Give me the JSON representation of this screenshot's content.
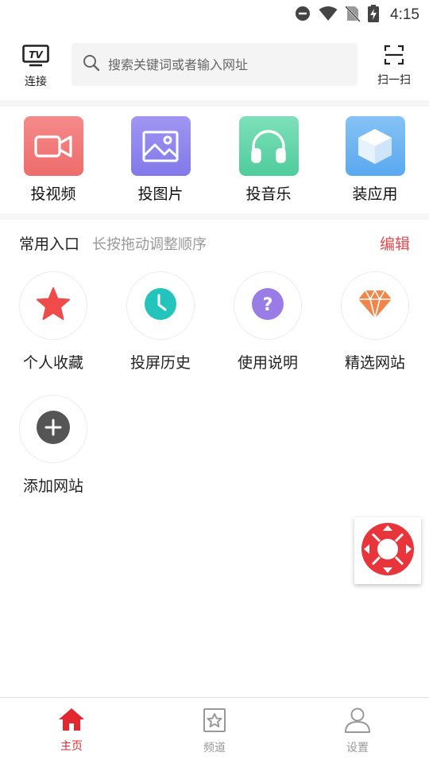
{
  "status_bar": {
    "time": "4:15",
    "icons": [
      "do-not-disturb-icon",
      "wifi-icon",
      "no-sim-icon",
      "battery-charging-icon"
    ]
  },
  "header": {
    "tv_label": "连接",
    "tv_icon_text": "TV",
    "search_placeholder": "搜索关键词或者输入网址",
    "scan_label": "扫一扫"
  },
  "cast_items": [
    {
      "label": "投视频",
      "icon": "video-camera-icon",
      "color": "#f07878"
    },
    {
      "label": "投图片",
      "icon": "image-icon",
      "color": "#8f86ee"
    },
    {
      "label": "投音乐",
      "icon": "headphones-icon",
      "color": "#5ed4a8"
    },
    {
      "label": "装应用",
      "icon": "cube-icon",
      "color": "#6cb4f4"
    }
  ],
  "common_entries": {
    "title": "常用入口",
    "hint": "长按拖动调整顺序",
    "edit_label": "编辑",
    "items": [
      {
        "label": "个人收藏",
        "icon": "star-icon",
        "color": "#f04b4b"
      },
      {
        "label": "投屏历史",
        "icon": "clock-icon",
        "color": "#22c4bc"
      },
      {
        "label": "使用说明",
        "icon": "question-icon",
        "color": "#9a7ce6"
      },
      {
        "label": "精选网站",
        "icon": "diamond-icon",
        "color": "#f0864a"
      },
      {
        "label": "添加网站",
        "icon": "plus-icon",
        "color": "#555555"
      }
    ]
  },
  "remote": {
    "icon": "remote-control-icon",
    "color": "#e8353b"
  },
  "bottom_nav": {
    "items": [
      {
        "label": "主页",
        "icon": "home-icon",
        "active": true
      },
      {
        "label": "频道",
        "icon": "channel-star-icon",
        "active": false
      },
      {
        "label": "设置",
        "icon": "user-icon",
        "active": false
      }
    ],
    "active_color": "#e0282e",
    "inactive_color": "#999999"
  }
}
